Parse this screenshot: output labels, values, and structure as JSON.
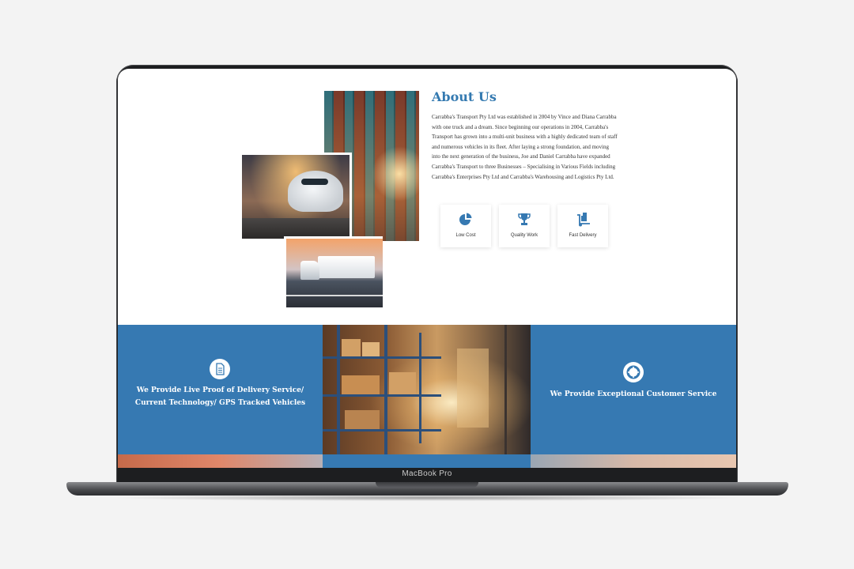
{
  "device": {
    "label": "MacBook Pro"
  },
  "about": {
    "title": "About Us",
    "body": "Carrabba's Transport Pty Ltd was established in 2004 by Vince and Diana Carrabba with one truck and a dream. Since beginning our operations in 2004, Carrabba's Transport has grown into a multi-unit business with a highly dedicated team of staff and numerous vehicles in its fleet. After laying a strong foundation, and moving into the next generation of the business, Joe and Daniel Carrabba have expanded Carrabba's Transport to three Businesses – Specialising in Various Fields including Carrabba's Enterprises Pty Ltd and Carrabba's Warehousing and Logistics Pty Ltd.",
    "features": [
      {
        "label": "Low Cost",
        "icon": "pie-chart-icon"
      },
      {
        "label": "Quality Work",
        "icon": "trophy-icon"
      },
      {
        "label": "Fast Delivery",
        "icon": "hand-truck-icon"
      }
    ]
  },
  "band": {
    "left": {
      "line1": "We Provide Live Proof of Delivery Service/",
      "line2": "Current Technology/ GPS Tracked Vehicles",
      "icon": "document-icon"
    },
    "right": {
      "text": "We Provide Exceptional Customer Service",
      "icon": "lifebuoy-icon"
    }
  },
  "colors": {
    "accent": "#3679b2",
    "title": "#3379b0",
    "background": "#f3f3f3"
  }
}
